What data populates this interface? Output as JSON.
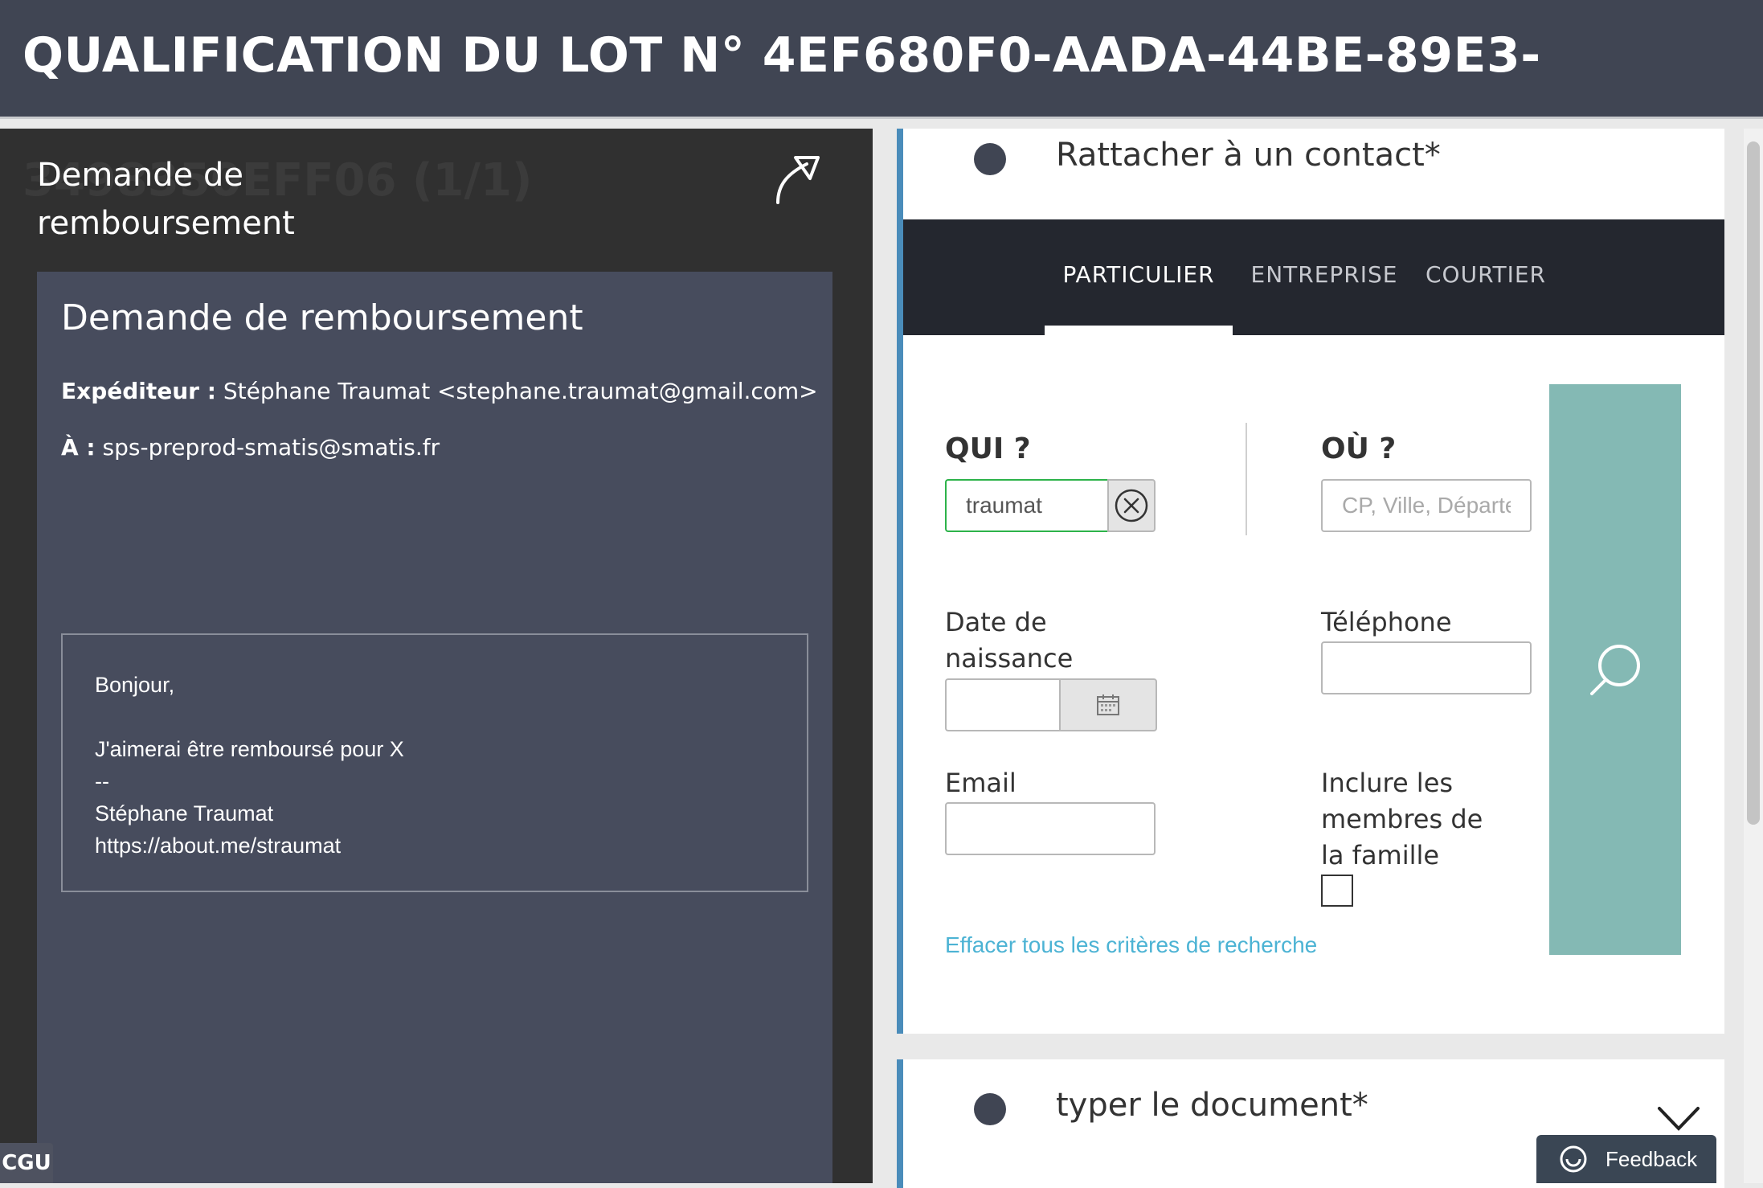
{
  "header": {
    "title": "QUALIFICATION DU LOT N° 4EF680F0-AADA-44BE-89E3-"
  },
  "left_panel": {
    "ghost_title": "3498350EFF06 (1/1)",
    "document_title_line1": "Demande de",
    "document_title_line2": "remboursement",
    "open_icon": "arrow-up-right-icon",
    "mail": {
      "subject": "Demande de remboursement",
      "sender_label": "Expéditeur :",
      "sender_value": "Stéphane Traumat <stephane.traumat@gmail.com>",
      "to_label": "À :",
      "to_value": "sps-preprod-smatis@smatis.fr",
      "body_lines": [
        "Bonjour,",
        "",
        "J'aimerai être remboursé pour X",
        "--",
        "Stéphane Traumat",
        "https://about.me/straumat"
      ]
    },
    "cgu_label": "CGU"
  },
  "contact_step": {
    "title": "Rattacher à un contact*",
    "tabs": [
      {
        "label": "PARTICULIER",
        "active": true
      },
      {
        "label": "ENTREPRISE",
        "active": false
      },
      {
        "label": "COURTIER",
        "active": false
      }
    ],
    "form": {
      "qui_label": "QUI ?",
      "qui_value": "traumat",
      "ou_label": "OÙ ?",
      "ou_placeholder": "CP, Ville, Département",
      "birth_label_line1": "Date de",
      "birth_label_line2": "naissance",
      "phone_label": "Téléphone",
      "email_label": "Email",
      "family_label_line1": "Inclure les",
      "family_label_line2": "membres de",
      "family_label_line3": "la famille",
      "family_checked": false,
      "clear_link": "Effacer tous les critères de recherche"
    }
  },
  "document_step": {
    "title": "typer le document*"
  },
  "feedback_label": "Feedback",
  "colors": {
    "header": "#404553",
    "left_background": "#303030",
    "mail_card": "#474c5d",
    "accent_border": "#4a8cba",
    "search_button": "#84b9b4",
    "active_input": "#2db34a",
    "link": "#4cb3d4"
  }
}
